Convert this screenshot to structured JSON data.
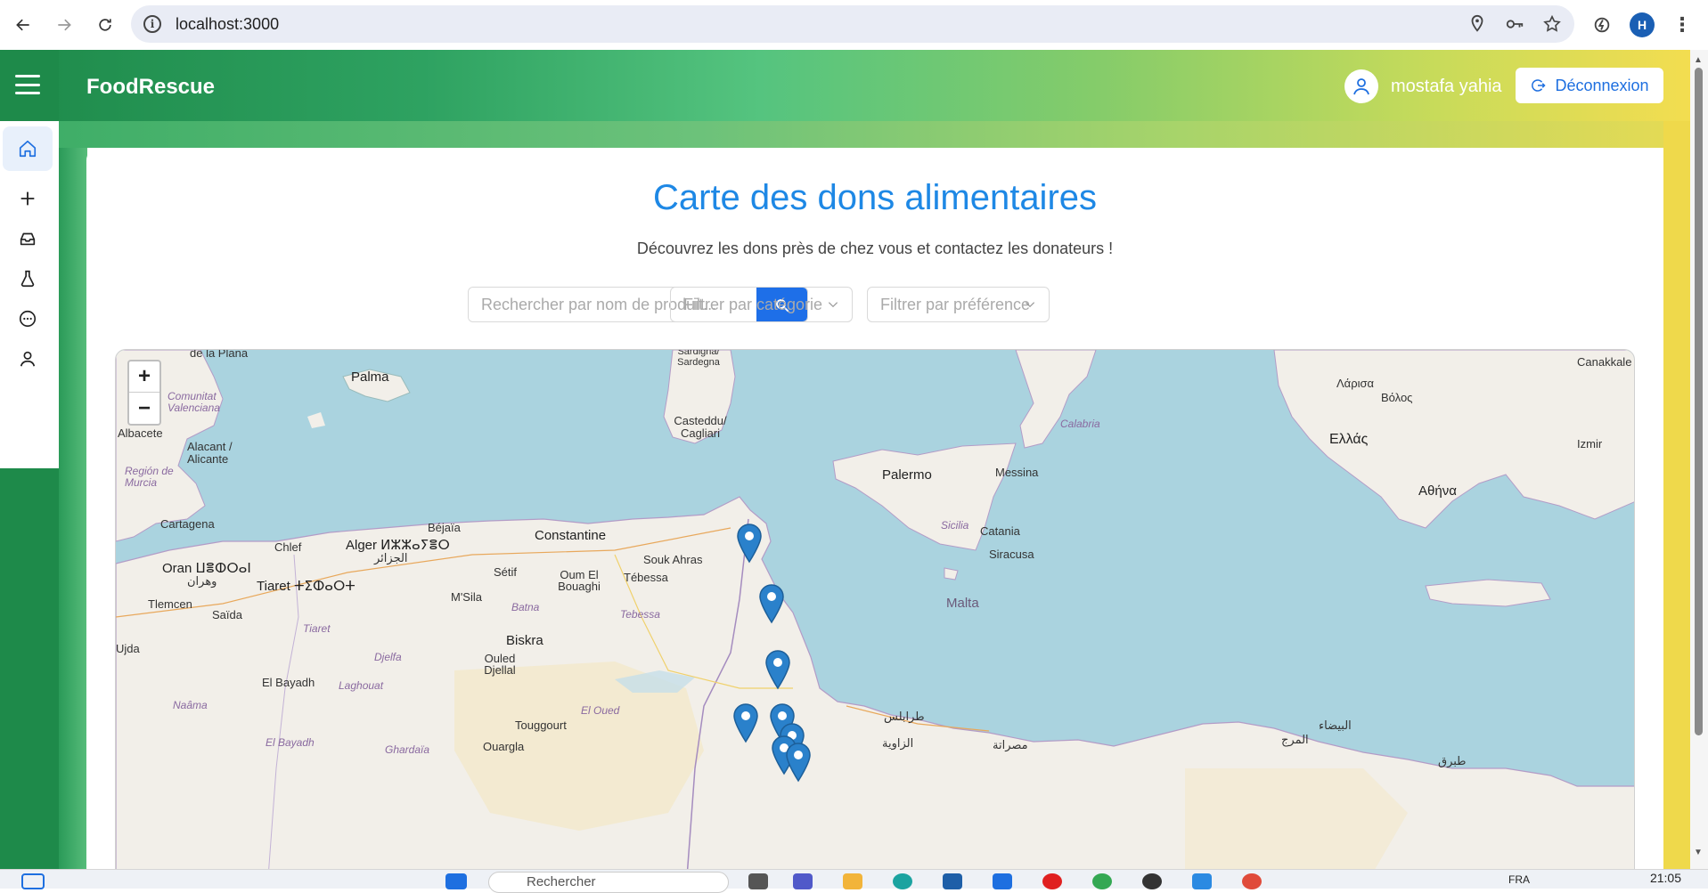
{
  "browser": {
    "url": "localhost:3000",
    "profile_initial": "H"
  },
  "app": {
    "brand": "FoodRescue",
    "user_name": "mostafa yahia",
    "logout_label": "Déconnexion"
  },
  "sidebar": {
    "items": [
      {
        "name": "home",
        "icon": "home-icon",
        "active": true
      },
      {
        "name": "add",
        "icon": "plus-icon",
        "active": false
      },
      {
        "name": "inbox",
        "icon": "inbox-icon",
        "active": false
      },
      {
        "name": "lab",
        "icon": "flask-icon",
        "active": false
      },
      {
        "name": "messages",
        "icon": "chat-icon",
        "active": false
      },
      {
        "name": "profile",
        "icon": "user-icon",
        "active": false
      }
    ]
  },
  "page": {
    "title": "Carte des dons alimentaires",
    "subtitle": "Découvrez les dons près de chez vous et contactez les donateurs !",
    "search_placeholder": "Rechercher par nom de produit...",
    "category_placeholder": "Filtrer par catégorie",
    "preference_placeholder": "Filtrer par préférence"
  },
  "map": {
    "zoom_in": "+",
    "zoom_out": "−",
    "places": [
      {
        "label": "de la Plana",
        "cls": ""
      },
      {
        "label": "Palma",
        "cls": "big"
      },
      {
        "label": "Sardigna/ Sardegna",
        "cls": ""
      },
      {
        "label": "Casteddu/ Cagliari",
        "cls": ""
      },
      {
        "label": "Comunitat Valenciana",
        "cls": "region"
      },
      {
        "label": "Albacete",
        "cls": ""
      },
      {
        "label": "Alacant / Alicante",
        "cls": ""
      },
      {
        "label": "Región de Murcia",
        "cls": "region"
      },
      {
        "label": "Cartagena",
        "cls": ""
      },
      {
        "label": "Calabria",
        "cls": "region"
      },
      {
        "label": "Palermo",
        "cls": "big"
      },
      {
        "label": "Messina",
        "cls": ""
      },
      {
        "label": "Sicilia",
        "cls": "region"
      },
      {
        "label": "Catania",
        "cls": ""
      },
      {
        "label": "Siracusa",
        "cls": ""
      },
      {
        "label": "Malta",
        "cls": "big"
      },
      {
        "label": "Ελλάς",
        "cls": "big"
      },
      {
        "label": "Λάρισα",
        "cls": ""
      },
      {
        "label": "Βόλος",
        "cls": ""
      },
      {
        "label": "Αθήνα",
        "cls": "big"
      },
      {
        "label": "Canakkale",
        "cls": ""
      },
      {
        "label": "Izmir",
        "cls": ""
      },
      {
        "label": "Béjaïa",
        "cls": ""
      },
      {
        "label": "Constantine",
        "cls": "big"
      },
      {
        "label": "Alger ⵍⵣⵣⴰⵢⴻⵔ",
        "cls": "big"
      },
      {
        "label": "الجزائر",
        "cls": ""
      },
      {
        "label": "Chlef",
        "cls": ""
      },
      {
        "label": "Oran ⵡⴻⵀⵔⴰⵏ",
        "cls": "big"
      },
      {
        "label": "وهران",
        "cls": ""
      },
      {
        "label": "Tiaret ⵜⵉⵀⴰⵔⵜ",
        "cls": "big"
      },
      {
        "label": "Sétif",
        "cls": ""
      },
      {
        "label": "Souk Ahras",
        "cls": ""
      },
      {
        "label": "Oum El Bouaghi",
        "cls": ""
      },
      {
        "label": "Tébessa",
        "cls": ""
      },
      {
        "label": "Tlemcen",
        "cls": ""
      },
      {
        "label": "Saïda",
        "cls": ""
      },
      {
        "label": "M'Sila",
        "cls": ""
      },
      {
        "label": "Batna",
        "cls": "region"
      },
      {
        "label": "Tiaret",
        "cls": "region"
      },
      {
        "label": "Biskra",
        "cls": "big"
      },
      {
        "label": "Djelfa",
        "cls": "region"
      },
      {
        "label": "Ouled Djellal",
        "cls": ""
      },
      {
        "label": "Laghouat",
        "cls": "region"
      },
      {
        "label": "El Bayadh",
        "cls": ""
      },
      {
        "label": "Naâma",
        "cls": "region"
      },
      {
        "label": "El Oued",
        "cls": "region"
      },
      {
        "label": "Touggourt",
        "cls": ""
      },
      {
        "label": "Ouargla",
        "cls": ""
      },
      {
        "label": "Ghardaïa",
        "cls": "region"
      },
      {
        "label": "El Bayadh",
        "cls": "region"
      },
      {
        "label": "طرابلس",
        "cls": ""
      },
      {
        "label": "مصراتة",
        "cls": ""
      },
      {
        "label": "الزاوية",
        "cls": ""
      },
      {
        "label": "البيضاء",
        "cls": ""
      },
      {
        "label": "المرج",
        "cls": ""
      },
      {
        "label": "طبرق",
        "cls": ""
      },
      {
        "label": "Tebessa",
        "cls": "region"
      },
      {
        "label": "Ujda",
        "cls": ""
      }
    ]
  },
  "taskbar": {
    "search_label": "Rechercher",
    "lang": "FRA",
    "time": "21:05"
  }
}
